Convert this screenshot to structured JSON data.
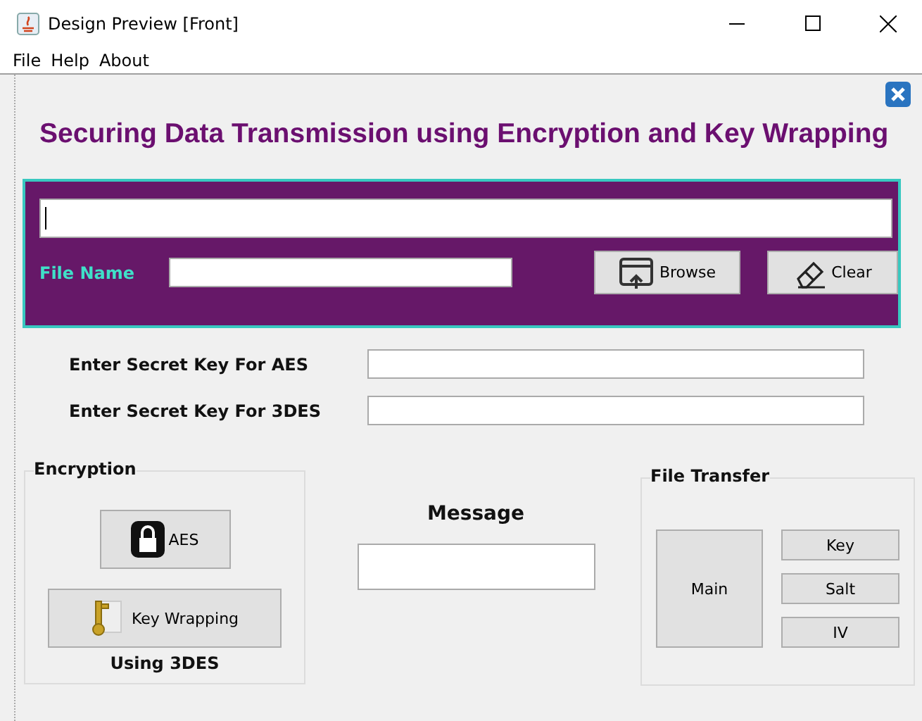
{
  "window": {
    "title": "Design Preview [Front]"
  },
  "menu": [
    "File",
    "Help",
    "About"
  ],
  "heading": "Securing Data Transmission using Encryption and Key Wrapping",
  "file_panel": {
    "path_field": {
      "focused": true
    },
    "file_name_label": "File Name",
    "buttons": [
      {
        "label": "Browse",
        "kind": "browse"
      },
      {
        "label": "Clear",
        "kind": "clear"
      }
    ]
  },
  "keys": [
    {
      "label": "Enter Secret Key For AES"
    },
    {
      "label": "Enter Secret Key For 3DES"
    }
  ],
  "encryption": {
    "title": "Encryption",
    "buttons": [
      {
        "label": "AES",
        "kind": "lock"
      },
      {
        "label": "Key Wrapping",
        "kind": "key"
      }
    ],
    "caption": "Using 3DES"
  },
  "message": {
    "label": "Message"
  },
  "file_transfer": {
    "title": "File  Transfer",
    "main": "Main",
    "buttons": [
      "Key",
      "Salt",
      "IV"
    ]
  }
}
